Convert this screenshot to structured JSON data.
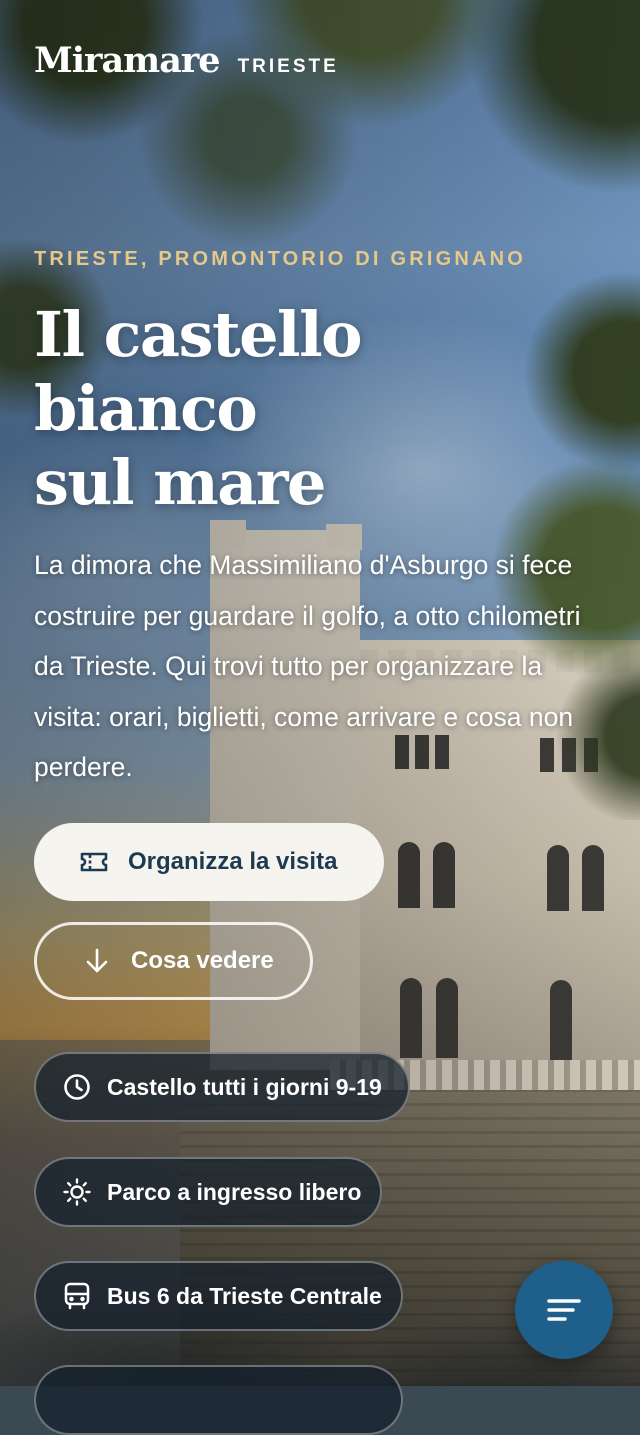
{
  "header": {
    "logo": "Miramare",
    "city": "TRIESTE"
  },
  "hero": {
    "eyebrow": "TRIESTE, PROMONTORIO DI GRIGNANO",
    "title_lines": [
      "Il castello",
      "bianco",
      "sul mare"
    ],
    "intro": "La dimora che Massimiliano d'Asburgo si fece costruire per guardare il golfo, a otto chilometri da Trieste. Qui trovi tutto per organizzare la visita: orari, biglietti, come arrivare e cosa non perdere."
  },
  "actions": {
    "primary": {
      "label": "Organizza la visita",
      "icon": "ticket-icon"
    },
    "secondary": {
      "label": "Cosa vedere",
      "icon": "arrow-down-icon"
    }
  },
  "info_pills": [
    {
      "label": "Castello tutti i giorni 9-19",
      "icon": "clock-icon"
    },
    {
      "label": "Parco a ingresso libero",
      "icon": "sun-icon"
    },
    {
      "label": "Bus 6 da Trieste Centrale",
      "icon": "bus-icon"
    },
    {
      "label": "",
      "icon": ""
    }
  ],
  "fab": {
    "icon": "menu-icon"
  },
  "colors": {
    "eyebrow": "#e6c989",
    "primary_button_bg": "#f6f4ef",
    "primary_button_text": "#1e3a52",
    "fab_bg": "#1f5f8b"
  }
}
